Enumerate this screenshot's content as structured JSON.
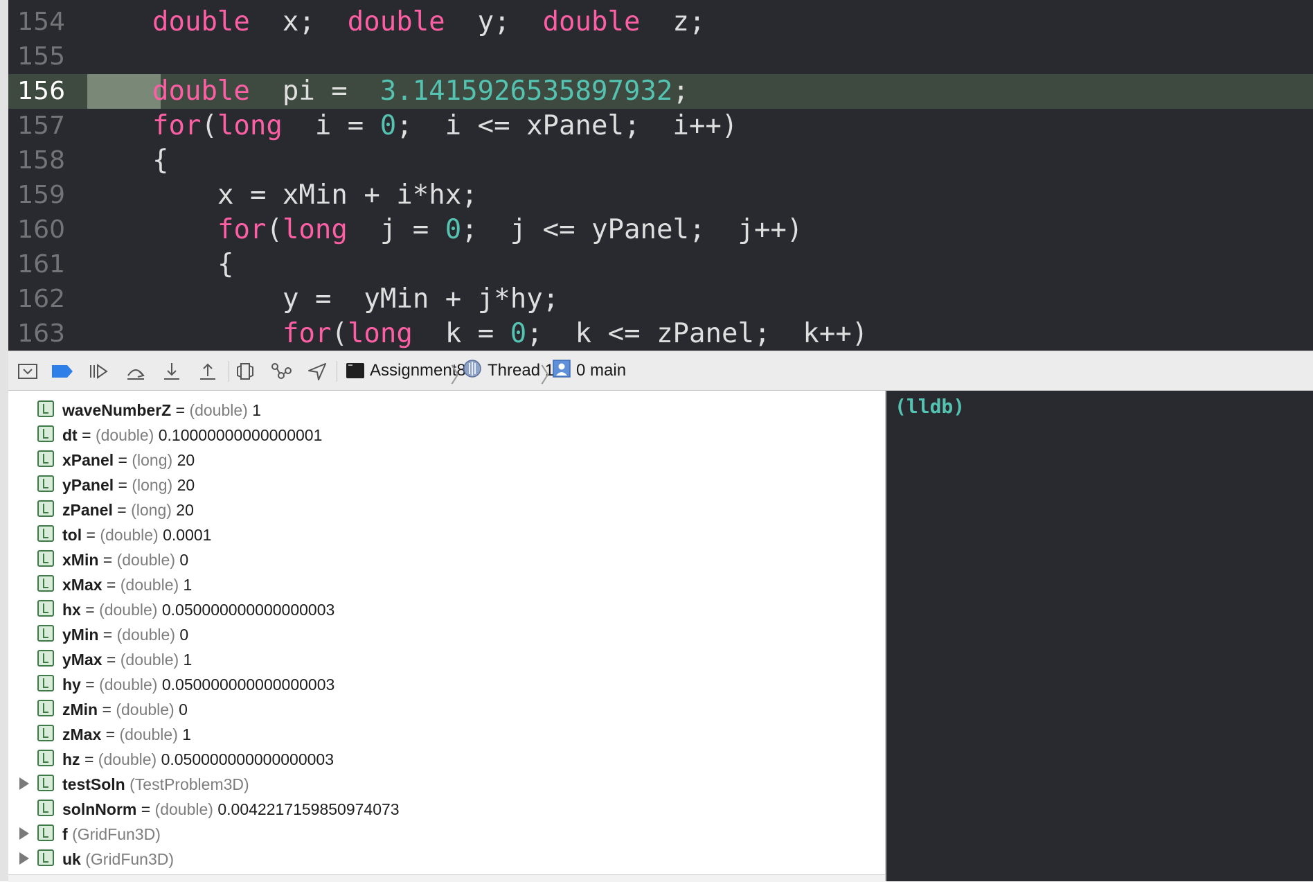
{
  "editor": {
    "current_line": "156",
    "lines": [
      {
        "num": "154",
        "tokens": [
          [
            "kw",
            "double"
          ],
          [
            "",
            "  x;  "
          ],
          [
            "kw",
            "double"
          ],
          [
            "",
            "  y;  "
          ],
          [
            "kw",
            "double"
          ],
          [
            "",
            "  z;"
          ]
        ],
        "indent": 0
      },
      {
        "num": "155",
        "tokens": [],
        "indent": 0
      },
      {
        "num": "156",
        "tokens": [
          [
            "kw",
            "double"
          ],
          [
            "",
            "  pi =  "
          ],
          [
            "num",
            "3.1415926535897932"
          ],
          [
            "",
            ";"
          ]
        ],
        "indent": 0
      },
      {
        "num": "157",
        "tokens": [
          [
            "kw",
            "for"
          ],
          [
            "",
            "("
          ],
          [
            "kw",
            "long"
          ],
          [
            "",
            "  i = "
          ],
          [
            "num",
            "0"
          ],
          [
            "",
            ";  i <= xPanel;  i++)"
          ]
        ],
        "indent": 0
      },
      {
        "num": "158",
        "tokens": [
          [
            "",
            "{"
          ]
        ],
        "indent": 0
      },
      {
        "num": "159",
        "tokens": [
          [
            "",
            "x = xMin + i*hx;"
          ]
        ],
        "indent": 1
      },
      {
        "num": "160",
        "tokens": [
          [
            "kw",
            "for"
          ],
          [
            "",
            "("
          ],
          [
            "kw",
            "long"
          ],
          [
            "",
            "  j = "
          ],
          [
            "num",
            "0"
          ],
          [
            "",
            ";  j <= yPanel;  j++)"
          ]
        ],
        "indent": 1
      },
      {
        "num": "161",
        "tokens": [
          [
            "",
            "{"
          ]
        ],
        "indent": 1
      },
      {
        "num": "162",
        "tokens": [
          [
            "",
            "y =  yMin + j*hy;"
          ]
        ],
        "indent": 2
      },
      {
        "num": "163",
        "tokens": [
          [
            "kw",
            "for"
          ],
          [
            "",
            "("
          ],
          [
            "kw",
            "long"
          ],
          [
            "",
            "  k = "
          ],
          [
            "num",
            "0"
          ],
          [
            "",
            ";  k <= zPanel;  k++)"
          ]
        ],
        "indent": 2
      }
    ]
  },
  "debugbar": {
    "icons": [
      "hide-debug-area-icon",
      "breakpoints-toggle-icon",
      "continue-icon",
      "step-over-icon",
      "step-into-icon",
      "step-out-icon",
      "view-hierarchy-icon",
      "memory-graph-icon",
      "simulate-location-icon"
    ],
    "breadcrumb": {
      "target": "Assignment8",
      "thread": "Thread 1",
      "frame": "0 main"
    }
  },
  "variables": [
    {
      "name": "waveNumberZ",
      "type": "(double)",
      "value": "1",
      "expandable": false
    },
    {
      "name": "dt",
      "type": "(double)",
      "value": "0.10000000000000001",
      "expandable": false
    },
    {
      "name": "xPanel",
      "type": "(long)",
      "value": "20",
      "expandable": false
    },
    {
      "name": "yPanel",
      "type": "(long)",
      "value": "20",
      "expandable": false
    },
    {
      "name": "zPanel",
      "type": "(long)",
      "value": "20",
      "expandable": false
    },
    {
      "name": "tol",
      "type": "(double)",
      "value": "0.0001",
      "expandable": false
    },
    {
      "name": "xMin",
      "type": "(double)",
      "value": "0",
      "expandable": false
    },
    {
      "name": "xMax",
      "type": "(double)",
      "value": "1",
      "expandable": false
    },
    {
      "name": "hx",
      "type": "(double)",
      "value": "0.050000000000000003",
      "expandable": false
    },
    {
      "name": "yMin",
      "type": "(double)",
      "value": "0",
      "expandable": false
    },
    {
      "name": "yMax",
      "type": "(double)",
      "value": "1",
      "expandable": false
    },
    {
      "name": "hy",
      "type": "(double)",
      "value": "0.050000000000000003",
      "expandable": false
    },
    {
      "name": "zMin",
      "type": "(double)",
      "value": "0",
      "expandable": false
    },
    {
      "name": "zMax",
      "type": "(double)",
      "value": "1",
      "expandable": false
    },
    {
      "name": "hz",
      "type": "(double)",
      "value": "0.050000000000000003",
      "expandable": false
    },
    {
      "name": "testSoln",
      "type": "(TestProblem3D)",
      "value": "",
      "expandable": true
    },
    {
      "name": "solnNorm",
      "type": "(double)",
      "value": "0.0042217159850974073",
      "expandable": false
    },
    {
      "name": "f",
      "type": "(GridFun3D)",
      "value": "",
      "expandable": true
    },
    {
      "name": "uk",
      "type": "(GridFun3D)",
      "value": "",
      "expandable": true
    }
  ],
  "console": {
    "prompt": "(lldb)"
  },
  "colors": {
    "editor_bg": "#292a30",
    "keyword": "#fc5fa3",
    "number": "#54c3b1",
    "current_line": "#3e4a3f",
    "local_badge": "#3d7a48"
  }
}
